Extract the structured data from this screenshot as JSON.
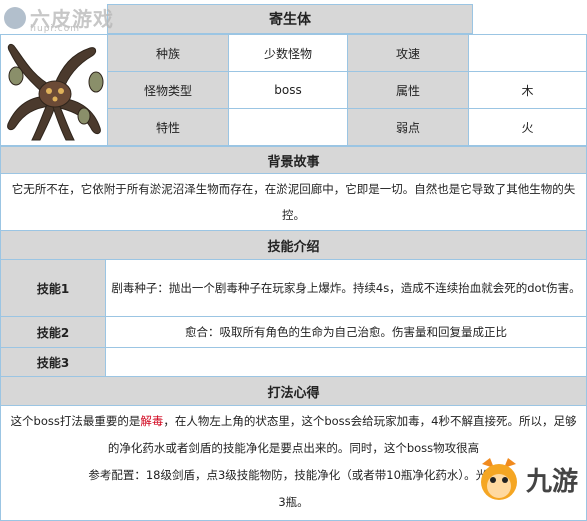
{
  "watermark": {
    "brand": "六皮游戏",
    "site": "liupi.com"
  },
  "monster": {
    "name": "寄生体"
  },
  "info": {
    "race_label": "种族",
    "race_value": "少数怪物",
    "speed_label": "攻速",
    "speed_value": "",
    "type_label": "怪物类型",
    "type_value": "boss",
    "attr_label": "属性",
    "attr_value": "木",
    "trait_label": "特性",
    "trait_value": "",
    "weak_label": "弱点",
    "weak_value": "火"
  },
  "background": {
    "title": "背景故事",
    "text": "它无所不在，它依附于所有淤泥沼泽生物而存在，在淤泥回廊中，它即是一切。自然也是它导致了其他生物的失控。"
  },
  "skills": {
    "title": "技能介绍",
    "items": [
      {
        "label": "技能1",
        "text": "剧毒种子：抛出一个剧毒种子在玩家身上爆炸。持续4s，造成不连续抬血就会死的dot伤害。"
      },
      {
        "label": "技能2",
        "text": "愈合：吸取所有角色的生命为自己治愈。伤害量和回复量成正比"
      },
      {
        "label": "技能3",
        "text": ""
      }
    ]
  },
  "tips": {
    "title": "打法心得",
    "line1_pre": "这个boss打法最重要的是",
    "line1_highlight": "解毒",
    "line1_post": "，在人物左上角的状态里，这个boss会给玩家加毒，4秒不解直接死。所以，足够",
    "line2": "的净化药水或者剑盾的技能净化是要点出来的。同时，这个boss物攻很高",
    "line3": "参考配置：18级剑盾，点3级技能物防，技能净化（或者带10瓶净化药水）。光环",
    "line4": "3瓶。"
  },
  "corner_logo": {
    "text": "九游"
  },
  "colors": {
    "border": "#9bc5e3",
    "header_bg": "#d7d7d7",
    "highlight": "#d0021b"
  }
}
